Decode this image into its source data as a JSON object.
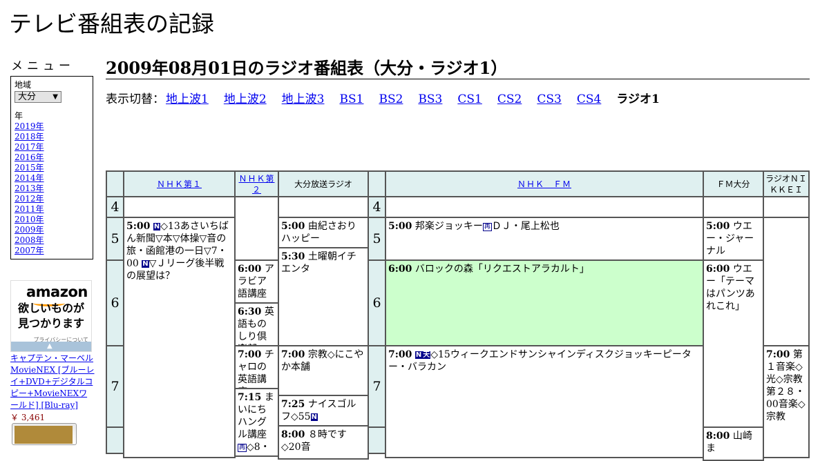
{
  "site": {
    "title": "テレビ番組表の記録"
  },
  "sidebar": {
    "menu_heading": "メニュー",
    "region_label": "地域",
    "region_value": "大分",
    "year_label": "年",
    "years": [
      "2019年",
      "2018年",
      "2017年",
      "2016年",
      "2015年",
      "2014年",
      "2013年",
      "2012年",
      "2011年",
      "2010年",
      "2009年",
      "2008年",
      "2007年"
    ],
    "ad": {
      "logo": "amazon",
      "copy": "欲しいものが見つかります",
      "privacy": "プライバシーについて",
      "product_title": "キャプテン・マーベル MovieNEX [ブルーレイ+DVD+デジタルコピー+MovieNEXワールド] [Blu-ray]",
      "product_price": "￥ 3,461"
    }
  },
  "main": {
    "heading": "2009年08月01日のラジオ番組表（大分・ラジオ1）",
    "switch_prefix": "表示切替：",
    "switch_links": [
      "地上波1",
      "地上波2",
      "地上波3",
      "BS1",
      "BS2",
      "BS3",
      "CS1",
      "CS2",
      "CS3",
      "CS4"
    ],
    "switch_current": "ラジオ1"
  },
  "schedule": {
    "channels": {
      "nhk1": "ＮＨＫ第１",
      "nhk2": "ＮＨＫ第２",
      "oita_radio": "大分放送ラジオ",
      "nhkfm": "ＮＨＫ　ＦＭ",
      "fm_oita": "ＦＭ大分",
      "radio_nikkei": "ラジオＮＩＫＫＥＩ"
    },
    "hours": {
      "h4": "4",
      "h5": "5",
      "h6": "6",
      "h7": "7"
    },
    "programs": {
      "nhk1_500": {
        "time": "5:00",
        "badge": "N",
        "title_a": "◇13あさいちばん新聞▽本▽体操▽音の旅・函館港の一日▽7・00",
        "badge2": "N",
        "title_b": "▽Ｊリーグ後半戦の展望は？"
      },
      "nhk2_600": {
        "time": "6:00",
        "title": "アラビア語講座"
      },
      "nhk2_630": {
        "time": "6:30",
        "title": "英語ものしり倶楽部"
      },
      "nhk2_700": {
        "time": "7:00",
        "title": "チャロの英語講座"
      },
      "nhk2_715": {
        "time": "7:15",
        "title": "まいにちハングル講座",
        "badge": "再",
        "tail": "◇8・"
      },
      "obs_500": {
        "time": "5:00",
        "title": "由紀さおりハッピー"
      },
      "obs_530": {
        "time": "5:30",
        "title": "土曜朝イチエンタ"
      },
      "obs_700": {
        "time": "7:00",
        "title": "宗教◇にこやか本舗"
      },
      "obs_725": {
        "time": "7:25",
        "title": "ナイスゴルフ◇55",
        "badge": "N"
      },
      "obs_800": {
        "time": "8:00",
        "title": "８時です◇20音"
      },
      "fm_500": {
        "time": "5:00",
        "title_a": "邦楽ジョッキー",
        "badge": "再",
        "title_b": "ＤＪ・尾上松也"
      },
      "fm_600": {
        "time": "6:00",
        "title": "バロックの森「リクエストアラカルト」"
      },
      "fm_700": {
        "time": "7:00",
        "badge": "N",
        "badge2": "天",
        "title": "◇15ウィークエンドサンシャインディスクジョッキーピーター・バラカン"
      },
      "fmo_500": {
        "time": "5:00",
        "title": "ウエー・ジャーナル"
      },
      "fmo_600": {
        "time": "6:00",
        "title": "ウエー「テーマはパンツあれこれ」"
      },
      "fmo_800": {
        "time": "8:00",
        "title": "山崎ま"
      },
      "nikkei_700": {
        "time": "7:00",
        "title": "第１音楽◇光◇宗教第２８・00音楽◇宗教"
      }
    }
  }
}
